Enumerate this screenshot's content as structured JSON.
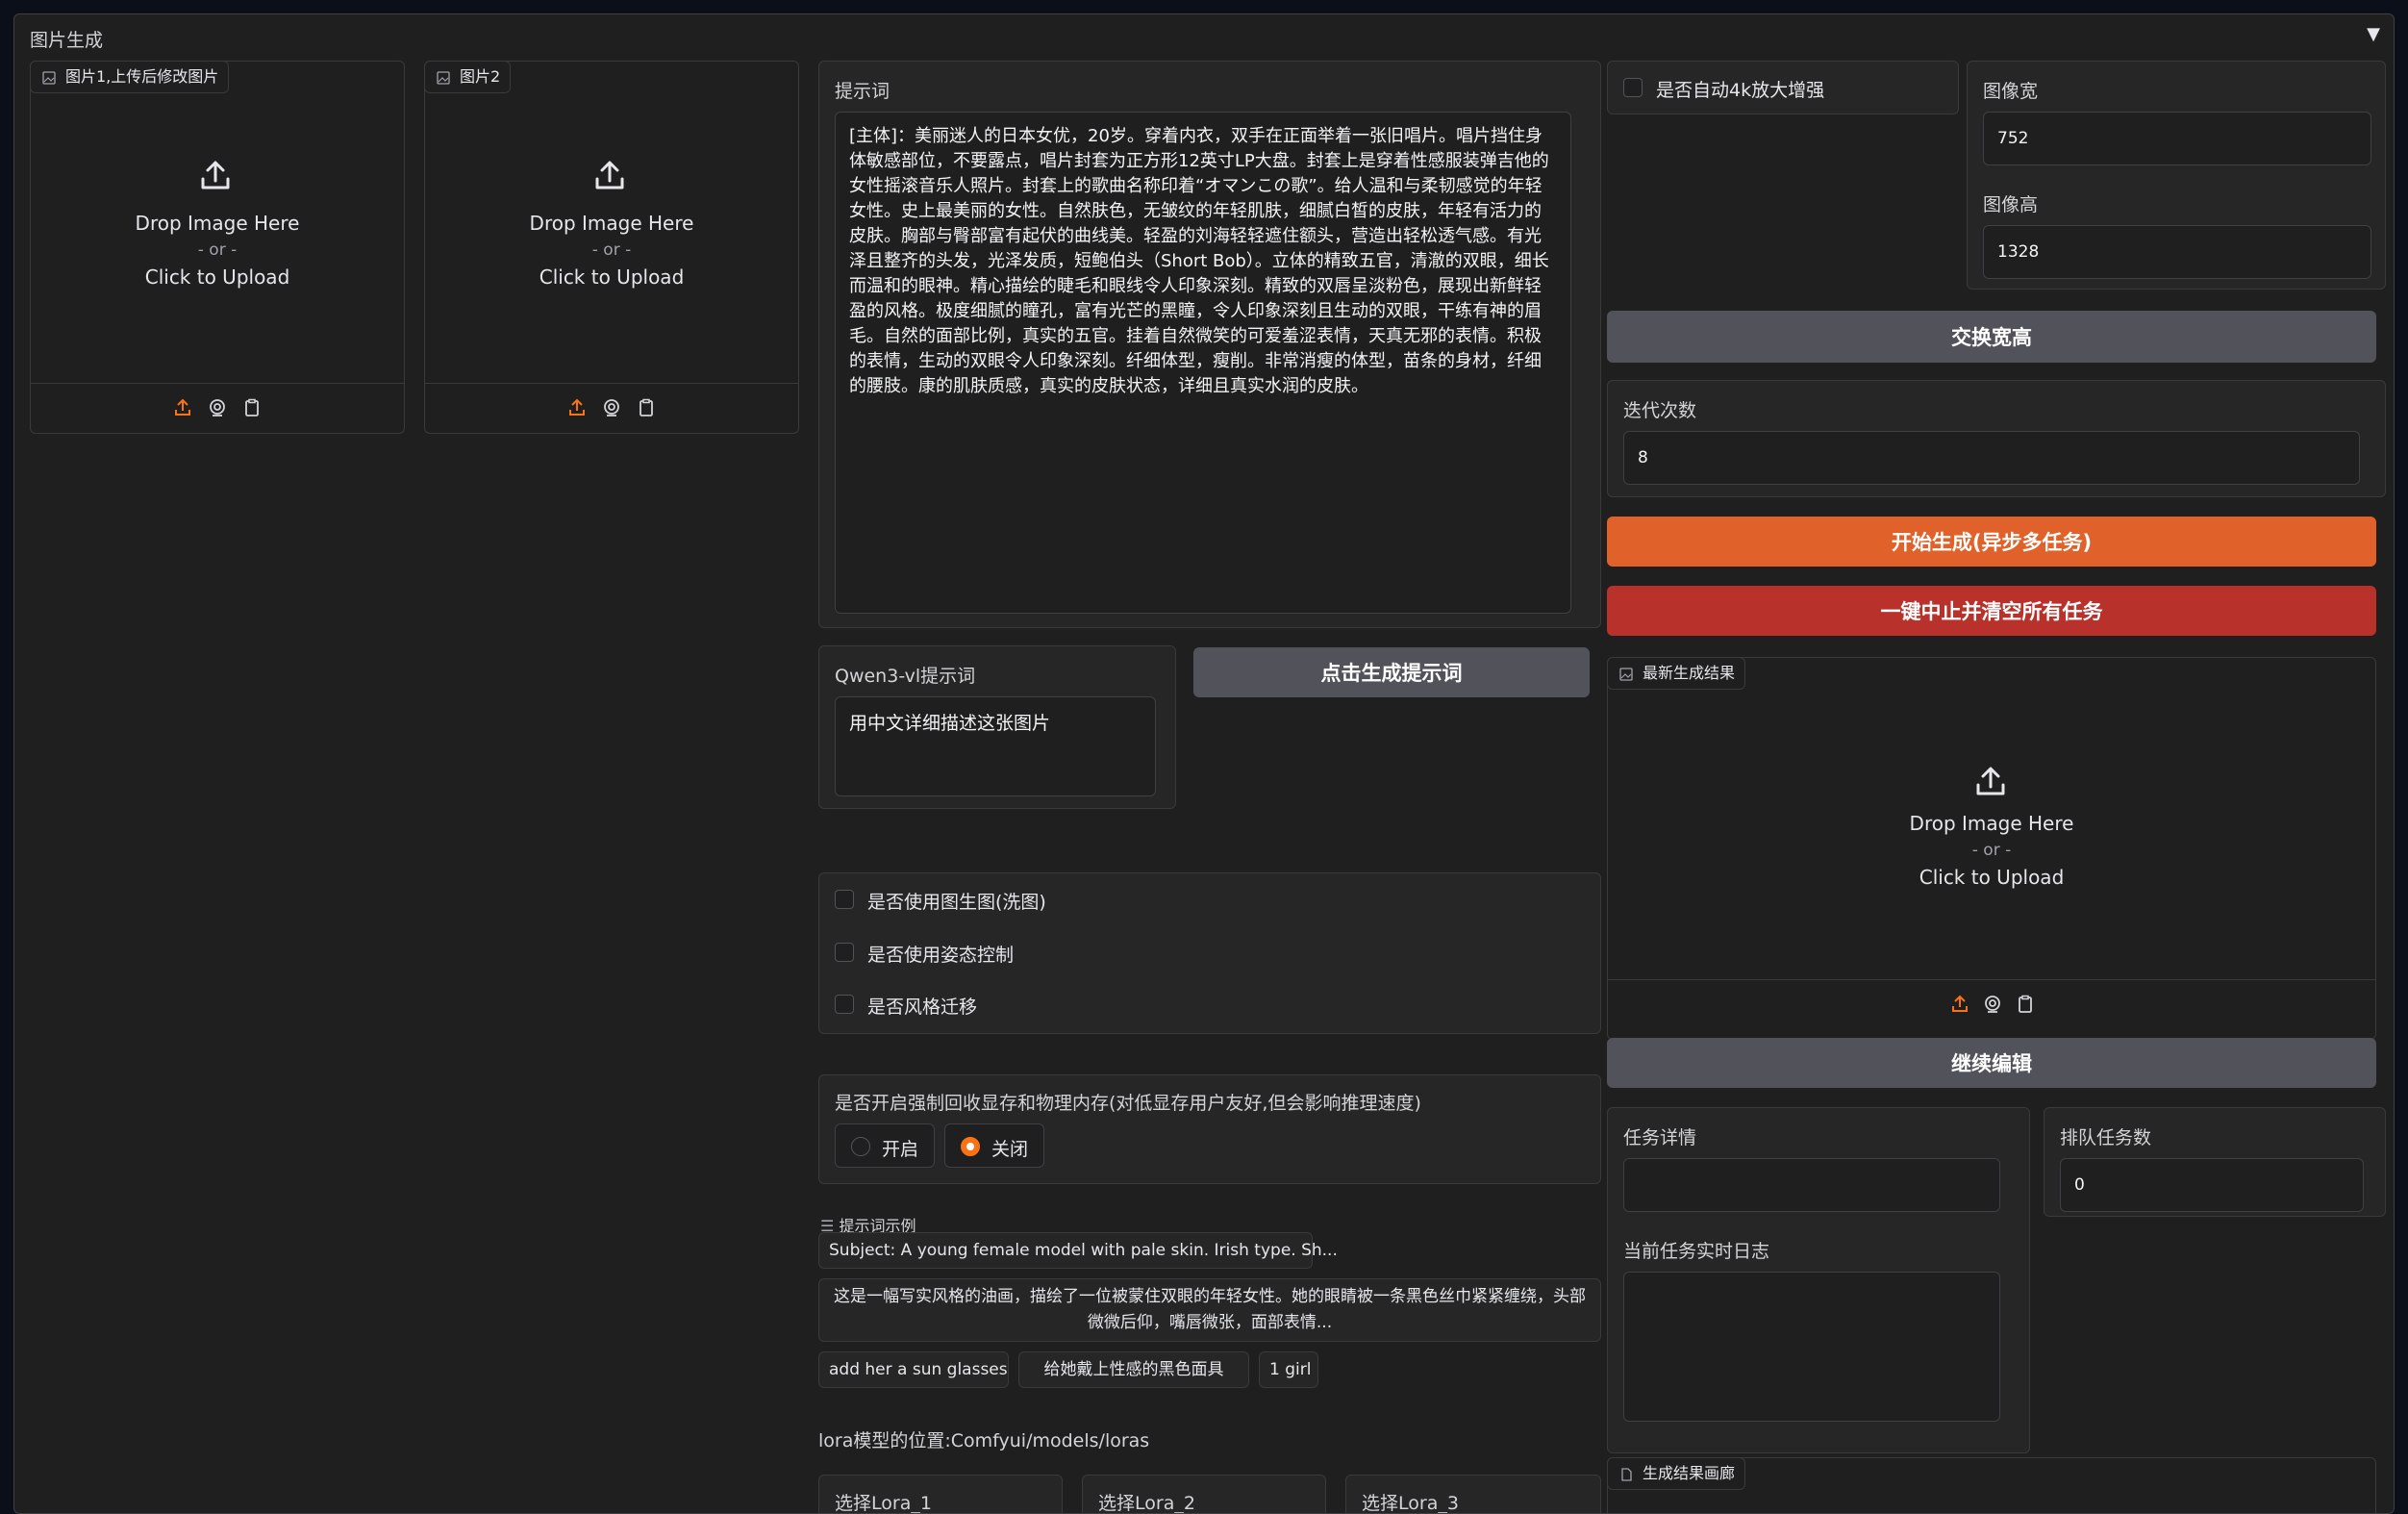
{
  "accordion": {
    "title": "图片生成",
    "toggle_icon": "▼"
  },
  "image1": {
    "label": "图片1,上传后修改图片",
    "drop": "Drop Image Here",
    "or": "- or -",
    "click": "Click to Upload"
  },
  "image2": {
    "label": "图片2",
    "drop": "Drop Image Here",
    "or": "- or -",
    "click": "Click to Upload"
  },
  "prompt": {
    "label": "提示词",
    "value": "[主体]：美丽迷人的日本女优，20岁。穿着内衣，双手在正面举着一张旧唱片。唱片挡住身体敏感部位，不要露点，唱片封套为正方形12英寸LP大盘。封套上是穿着性感服装弹吉他的女性摇滚音乐人照片。封套上的歌曲名称印着“オマンこの歌”。给人温和与柔韧感觉的年轻女性。史上最美丽的女性。自然肤色，无皱纹的年轻肌肤，细腻白皙的皮肤，年轻有活力的皮肤。胸部与臀部富有起伏的曲线美。轻盈的刘海轻轻遮住额头，营造出轻松透气感。有光泽且整齐的头发，光泽发质，短鲍伯头（Short Bob）。立体的精致五官，清澈的双眼，细长而温和的眼神。精心描绘的睫毛和眼线令人印象深刻。精致的双唇呈淡粉色，展现出新鲜轻盈的风格。极度细腻的瞳孔，富有光芒的黑瞳，令人印象深刻且生动的双眼，干练有神的眉毛。自然的面部比例，真实的五官。挂着自然微笑的可爱羞涩表情，天真无邪的表情。积极的表情，生动的双眼令人印象深刻。纤细体型，瘦削。非常消瘦的体型，苗条的身材，纤细的腰肢。康的肌肤质感，真实的皮肤状态，详细且真实水润的皮肤。"
  },
  "qwen": {
    "label": "Qwen3-vl提示词",
    "value": "用中文详细描述这张图片",
    "button": "点击生成提示词"
  },
  "options": {
    "img2img": "是否使用图生图(洗图)",
    "pose": "是否使用姿态控制",
    "style": "是否风格迁移"
  },
  "memory": {
    "label": "是否开启强制回收显存和物理内存(对低显存用户友好,但会影响推理速度)",
    "on": "开启",
    "off": "关闭"
  },
  "examples": {
    "label": "提示词示例",
    "items": [
      "Subject: A young female model with pale skin. Irish type. Sh...",
      "这是一幅写实风格的油画，描绘了一位被蒙住双眼的年轻女性。她的眼睛被一条黑色丝巾紧紧缠绕，头部微微后仰，嘴唇微张，面部表情...",
      "add her a sun glasses",
      "给她戴上性感的黑色面具",
      "1 girl"
    ]
  },
  "lora": {
    "path_label": "lora模型的位置:Comfyui/models/loras",
    "l1": "选择Lora_1",
    "l2": "选择Lora_2",
    "l3": "选择Lora_3"
  },
  "right": {
    "upscale": "是否自动4k放大增强",
    "width_label": "图像宽",
    "width": "752",
    "height_label": "图像高",
    "height": "1328",
    "swap": "交换宽高",
    "iter_label": "迭代次数",
    "iter": "8",
    "start": "开始生成(异步多任务)",
    "stop": "一键中止并清空所有任务",
    "result_label": "最新生成结果",
    "drop": "Drop Image Here",
    "or": "- or -",
    "click": "Click to Upload",
    "continue": "继续编辑",
    "task_detail": "任务详情",
    "queue_label": "排队任务数",
    "queue": "0",
    "log_label": "当前任务实时日志",
    "gallery": "生成结果画廊"
  },
  "colors": {
    "accent": "#e0622a",
    "danger": "#b8312b",
    "secondary": "#52525b",
    "icon_orange": "#f97316"
  }
}
